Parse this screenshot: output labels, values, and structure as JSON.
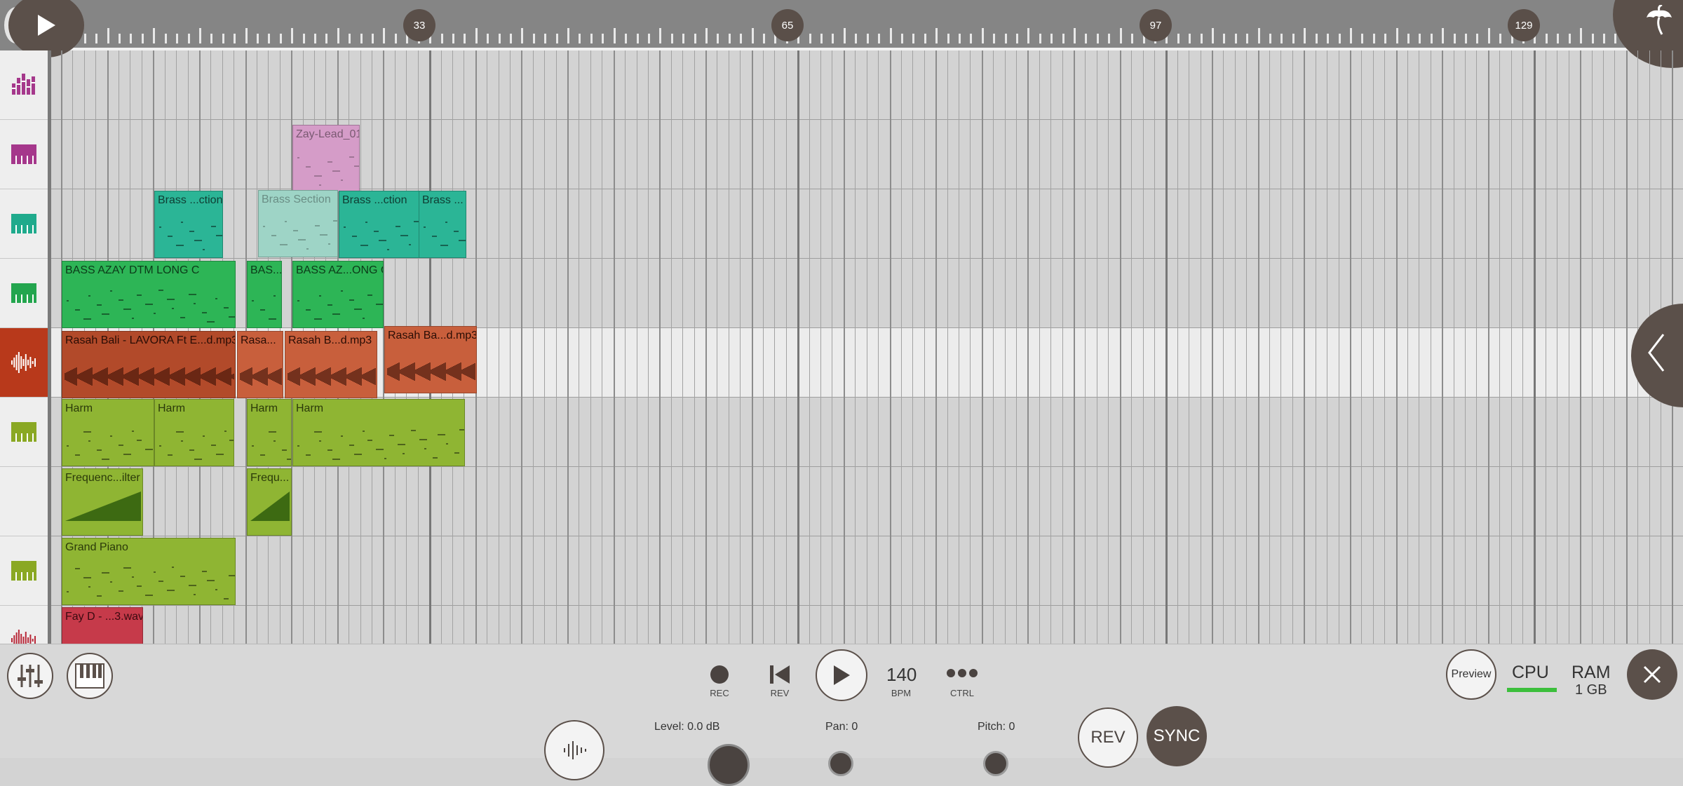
{
  "ruler": {
    "markers": [
      "33",
      "65",
      "97",
      "129"
    ]
  },
  "track_headers": [
    {
      "name": "mixer-bars-track-icon",
      "color": "#a5378b",
      "selected": false
    },
    {
      "name": "piano-track-icon",
      "color": "#a5378b",
      "selected": false
    },
    {
      "name": "piano-track-icon",
      "color": "#1faa8c",
      "selected": false
    },
    {
      "name": "piano-track-icon",
      "color": "#23a54e",
      "selected": false
    },
    {
      "name": "audio-waveform-track-icon",
      "color": "#ffffff",
      "selected": true
    },
    {
      "name": "piano-track-icon",
      "color": "#8aa823",
      "selected": false
    },
    {
      "name": "empty-track",
      "color": "",
      "selected": false
    },
    {
      "name": "piano-track-icon",
      "color": "#8aa823",
      "selected": false
    },
    {
      "name": "audio-waveform-track-icon",
      "color": "#b82838",
      "selected": false
    }
  ],
  "clips": [
    {
      "track": 1,
      "label": "Zay-Lead_01",
      "color": "#d59cc8",
      "text": "#7a5a72",
      "faded": true
    },
    {
      "track": 2,
      "label": "Brass ...ction",
      "color": "#2bb596",
      "text": "#0f3d33",
      "faded": false
    },
    {
      "track": 2,
      "label": "Brass Section",
      "color": "#9ed4c6",
      "text": "#6a8e85",
      "faded": true
    },
    {
      "track": 2,
      "label": "Brass ...ction",
      "color": "#2bb596",
      "text": "#0f3d33",
      "faded": false
    },
    {
      "track": 2,
      "label": "Brass ...",
      "color": "#2bb596",
      "text": "#0f3d33",
      "faded": false
    },
    {
      "track": 3,
      "label": "BASS AZAY DTM LONG C",
      "color": "#2db556",
      "text": "#0c3a19",
      "faded": false
    },
    {
      "track": 3,
      "label": "BAS...",
      "color": "#2db556",
      "text": "#0c3a19",
      "faded": false
    },
    {
      "track": 3,
      "label": "BASS AZ...ONG C",
      "color": "#2db556",
      "text": "#0c3a19",
      "faded": false
    },
    {
      "track": 4,
      "label": "Rasah Bali - LAVORA Ft E...d.mp3",
      "color": "#b24a2a",
      "text": "#2a0d05",
      "faded": false
    },
    {
      "track": 4,
      "label": "Rasa...",
      "color": "#c85f3c",
      "text": "#2a0d05",
      "faded": false
    },
    {
      "track": 4,
      "label": "Rasah B...d.mp3",
      "color": "#c85f3c",
      "text": "#2a0d05",
      "faded": false
    },
    {
      "track": 4,
      "label": "Rasah Ba...d.mp3",
      "color": "#c85f3c",
      "text": "#2a0d05",
      "faded": false
    },
    {
      "track": 5,
      "label": "Harm",
      "color": "#8fb533",
      "text": "#2b3a0a",
      "faded": false
    },
    {
      "track": 5,
      "label": "Harm",
      "color": "#8fb533",
      "text": "#2b3a0a",
      "faded": false
    },
    {
      "track": 5,
      "label": "Harm",
      "color": "#8fb533",
      "text": "#2b3a0a",
      "faded": false
    },
    {
      "track": 5,
      "label": "Harm",
      "color": "#8fb533",
      "text": "#2b3a0a",
      "faded": false
    },
    {
      "track": 6,
      "label": "Frequenc...ilter",
      "color": "#8fb533",
      "text": "#2b3a0a",
      "faded": false
    },
    {
      "track": 6,
      "label": "Frequ...",
      "color": "#8fb533",
      "text": "#2b3a0a",
      "faded": false
    },
    {
      "track": 7,
      "label": "Grand Piano",
      "color": "#8fb533",
      "text": "#2b3a0a",
      "faded": false
    },
    {
      "track": 8,
      "label": "Fay D - ...3.wav",
      "color": "#c63a4a",
      "text": "#3a0a10",
      "faded": false
    }
  ],
  "transport": {
    "rec_label": "REC",
    "rev_label": "REV",
    "bpm_value": "140",
    "bpm_label": "BPM",
    "ctrl_label": "CTRL"
  },
  "right": {
    "preview_label": "Preview",
    "cpu_label": "CPU",
    "cpu_color": "#3cbf3c",
    "ram_label": "RAM",
    "ram_value": "1 GB"
  },
  "controls": {
    "level_label": "Level: 0.0 dB",
    "pan_label": "Pan: 0",
    "pitch_label": "Pitch: 0",
    "rev_button": "REV",
    "sync_button": "SYNC"
  }
}
